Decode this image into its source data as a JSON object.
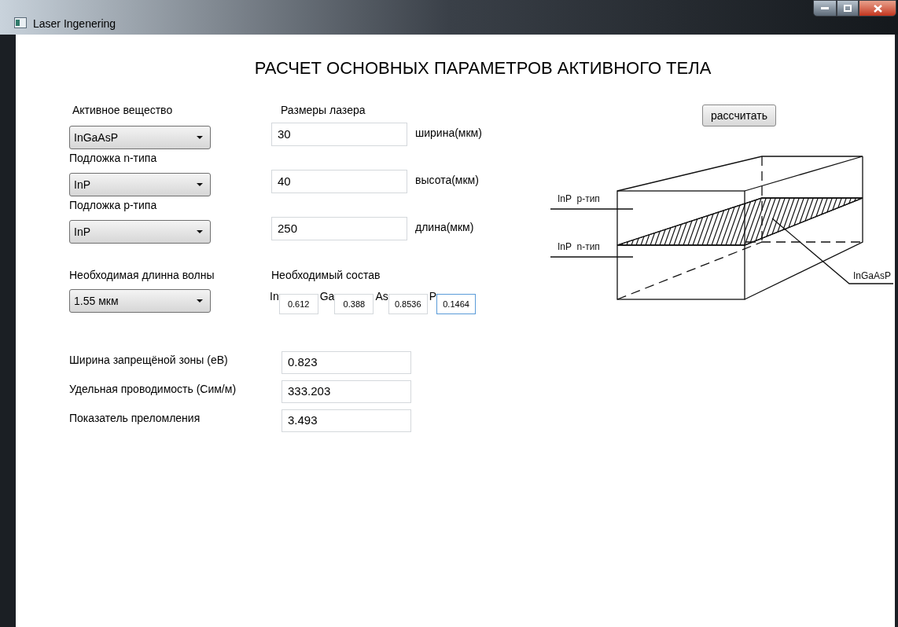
{
  "window": {
    "title": "Laser Ingenering"
  },
  "heading": "РАСЧЕТ ОСНОВНЫХ ПАРАМЕТРОВ АКТИВНОГО ТЕЛА",
  "size_label": "Размеры лазера",
  "selectors": [
    {
      "label": "Активное вещество",
      "value": "InGaAsP"
    },
    {
      "label": "Подложка n-типа",
      "value": "InP"
    },
    {
      "label": "Подложка p-типа",
      "value": "InP"
    }
  ],
  "sizes": [
    {
      "value": "30",
      "unit": "ширина(мкм)"
    },
    {
      "value": "40",
      "unit": "высота(мкм)"
    },
    {
      "value": "250",
      "unit": "длина(мкм)"
    }
  ],
  "wavelength": {
    "label": "Необходимая длинна волны",
    "value": "1.55 мкм"
  },
  "composition": {
    "label": "Необходимый состав",
    "elements": [
      {
        "symbol": "In",
        "value": "0.612",
        "focused": false
      },
      {
        "symbol": "Ga",
        "value": "0.388",
        "focused": false
      },
      {
        "symbol": "As",
        "value": "0.8536",
        "focused": false
      },
      {
        "symbol": "P",
        "value": "0.1464",
        "focused": true
      }
    ]
  },
  "results": [
    {
      "label": "Ширина запрещёной зоны (еВ)",
      "value": "0.823"
    },
    {
      "label": "Удельная проводимость (Сим/м)",
      "value": "333.203"
    },
    {
      "label": "Показатель преломления",
      "value": "3.493"
    }
  ],
  "calculate_button": "рассчитать",
  "diagram": {
    "labels": [
      "InP  p-тип",
      "InP  n-тип",
      "InGaAsP"
    ]
  }
}
